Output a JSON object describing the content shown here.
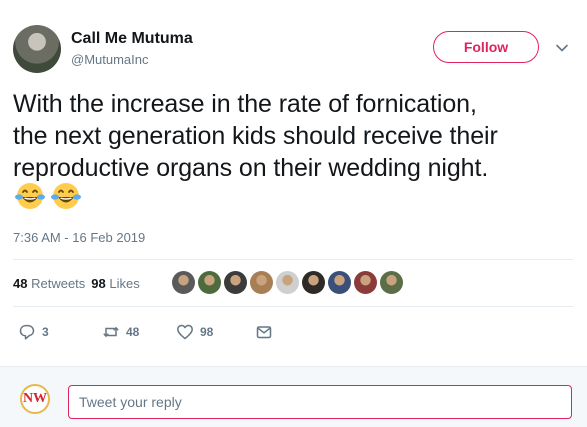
{
  "author": {
    "name": "Call Me Mutuma",
    "handle": "@MutumaInc"
  },
  "follow_label": "Follow",
  "tweet": {
    "lines": [
      "With the increase in the rate of fornication,",
      "the next generation kids should receive their",
      "reproductive organs on their wedding night."
    ],
    "emojis": [
      "face-with-tears-of-joy",
      "face-with-tears-of-joy"
    ],
    "timestamp": "7:36 AM - 16 Feb 2019"
  },
  "stats": {
    "retweets_count": "48",
    "retweets_label": "Retweets",
    "likes_count": "98",
    "likes_label": "Likes"
  },
  "liker_face_colors": [
    "#5a5a5a",
    "#4d6b3e",
    "#3b3b3b",
    "#a87f55",
    "#cfcfcf",
    "#2e2a28",
    "#3a4f7a",
    "#8c3b3b",
    "#5c6e48"
  ],
  "actions": {
    "replies": "3",
    "retweets": "48",
    "likes": "98"
  },
  "reply": {
    "avatar_text": "NW",
    "placeholder": "Tweet your reply"
  },
  "colors": {
    "accent": "#e0245e",
    "muted": "#657786",
    "text": "#14171a"
  }
}
